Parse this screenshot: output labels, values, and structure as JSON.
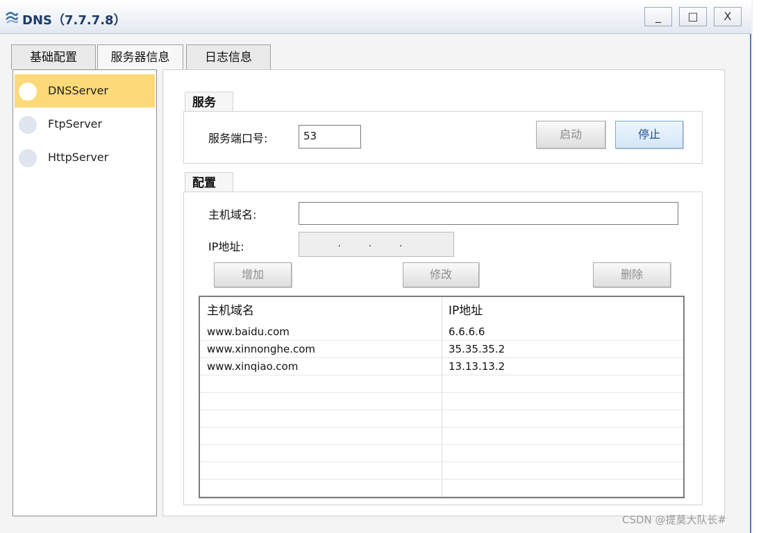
{
  "window": {
    "title": "DNS（7.7.7.8）",
    "icon": "network-icon",
    "controls": {
      "minimize": "_",
      "maximize": "□",
      "close": "X"
    }
  },
  "tabs": [
    {
      "label": "基础配置"
    },
    {
      "label": "服务器信息"
    },
    {
      "label": "日志信息"
    }
  ],
  "sidebar": {
    "items": [
      {
        "label": "DNSServer",
        "selected": true
      },
      {
        "label": "FtpServer",
        "selected": false
      },
      {
        "label": "HttpServer",
        "selected": false
      }
    ]
  },
  "service": {
    "group_title": "服务",
    "port_label": "服务端口号:",
    "port_value": "53",
    "start_label": "启动",
    "stop_label": "停止"
  },
  "config": {
    "group_title": "配置",
    "host_label": "主机域名:",
    "host_value": "",
    "ip_label": "IP地址:",
    "ip_value": " .  .  . ",
    "add_label": "增加",
    "edit_label": "修改",
    "delete_label": "删除"
  },
  "table": {
    "headers": [
      "主机域名",
      "IP地址"
    ],
    "rows": [
      [
        "www.baidu.com",
        "6.6.6.6"
      ],
      [
        "www.xinnonghe.com",
        "35.35.35.2"
      ],
      [
        "www.xinqiao.com",
        "13.13.13.2"
      ]
    ]
  },
  "watermark": "CSDN @提莫大队长#",
  "colors": {
    "selected_item": "#fcd979",
    "title_text": "#1d3b6a",
    "stop_button": "#d5e6f7"
  }
}
